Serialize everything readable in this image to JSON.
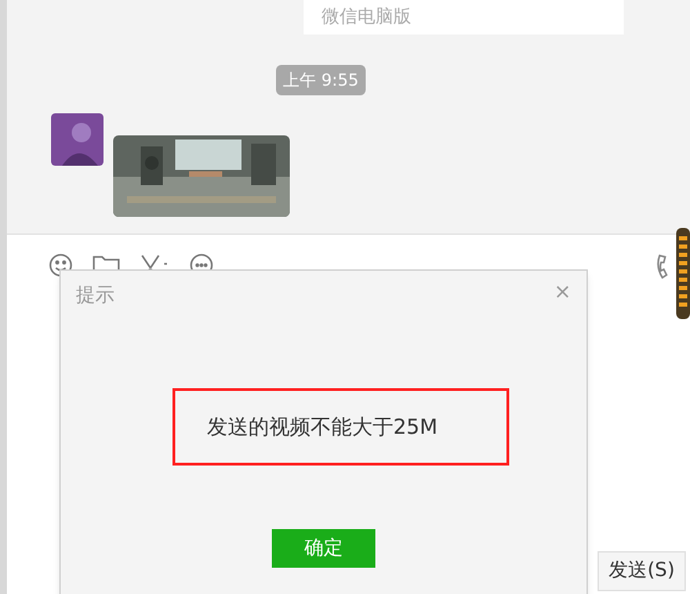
{
  "chat": {
    "source_card": {
      "text": "微信电脑版"
    },
    "timestamp": "上午 9:55",
    "messages": [
      {
        "kind": "video"
      }
    ]
  },
  "composer": {
    "send_button": "发送(S)"
  },
  "dialog": {
    "title": "提示",
    "close": "×",
    "message": "发送的视频不能大于25M",
    "confirm": "确定",
    "message_highlighted": true
  }
}
